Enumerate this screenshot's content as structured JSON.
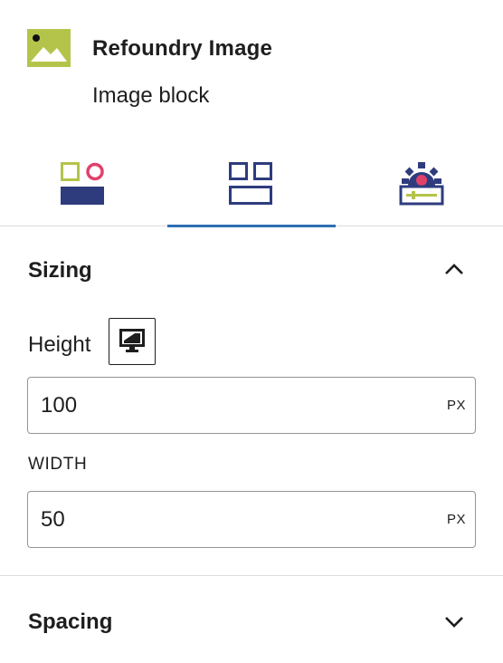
{
  "block": {
    "title": "Refoundry Image",
    "description": "Image block",
    "icon": "image-landscape-icon",
    "icon_color": "#b4c44b"
  },
  "tabs": [
    {
      "name": "style-tab",
      "icon": "style-shapes-icon",
      "active": false
    },
    {
      "name": "layout-tab",
      "icon": "layout-grid-icon",
      "active": true
    },
    {
      "name": "advanced-tab",
      "icon": "gear-settings-icon",
      "active": false
    }
  ],
  "sizing": {
    "title": "Sizing",
    "expanded": true,
    "height_label": "Height",
    "height_value": "100",
    "height_unit": "PX",
    "device_icon": "desktop-icon",
    "width_label": "WIDTH",
    "width_value": "50",
    "width_unit": "PX"
  },
  "spacing": {
    "title": "Spacing",
    "expanded": false
  },
  "colors": {
    "accent": "#2f6fb5",
    "navy": "#2e3c7e",
    "pink": "#e0416b",
    "olive": "#b4c44b"
  }
}
